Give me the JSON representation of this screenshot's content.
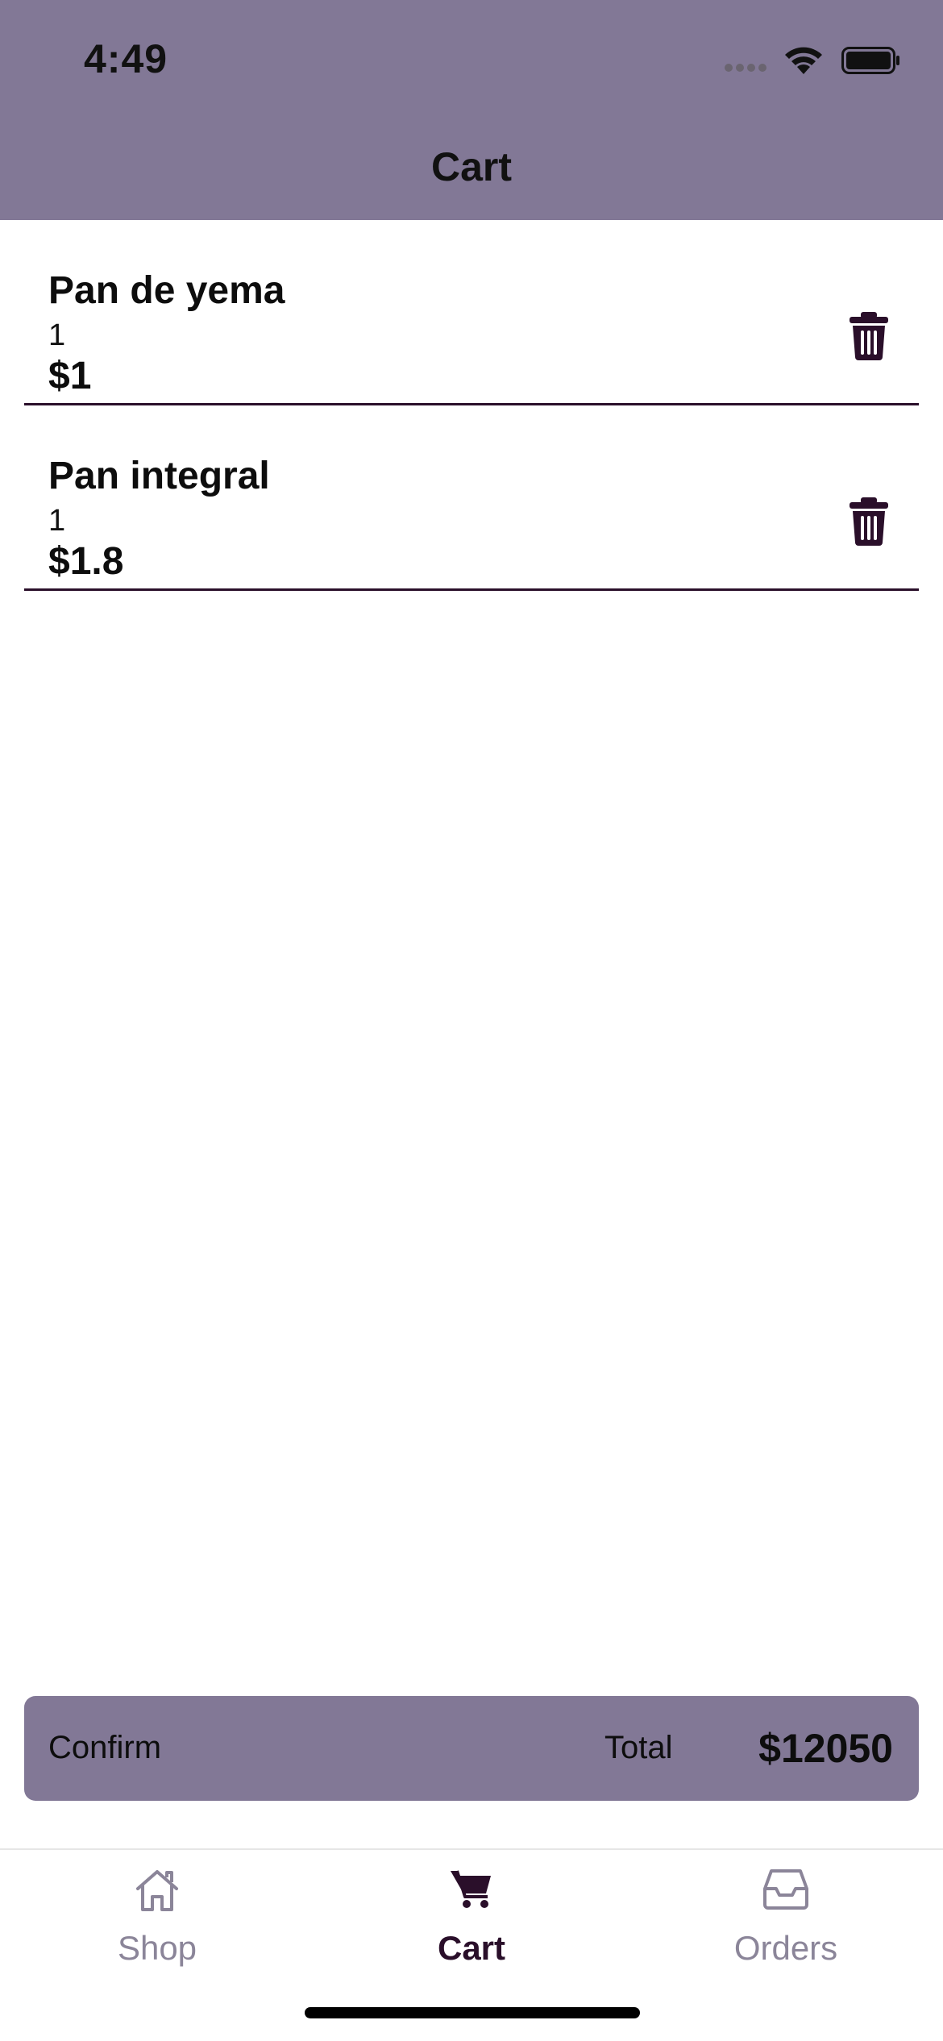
{
  "status_bar": {
    "time": "4:49"
  },
  "header": {
    "title": "Cart"
  },
  "cart": {
    "items": [
      {
        "name": "Pan de yema",
        "quantity": "1",
        "price": "$1"
      },
      {
        "name": "Pan integral",
        "quantity": "1",
        "price": "$1.8"
      }
    ]
  },
  "confirm_bar": {
    "confirm_label": "Confirm",
    "total_label": "Total",
    "total_value": "$12050"
  },
  "tabs": [
    {
      "label": "Shop",
      "icon": "home-icon",
      "active": false
    },
    {
      "label": "Cart",
      "icon": "cart-icon",
      "active": true
    },
    {
      "label": "Orders",
      "icon": "inbox-icon",
      "active": false
    }
  ],
  "colors": {
    "header_bg": "#827896",
    "accent": "#2a0f2a",
    "inactive_tab": "#8b8599"
  }
}
